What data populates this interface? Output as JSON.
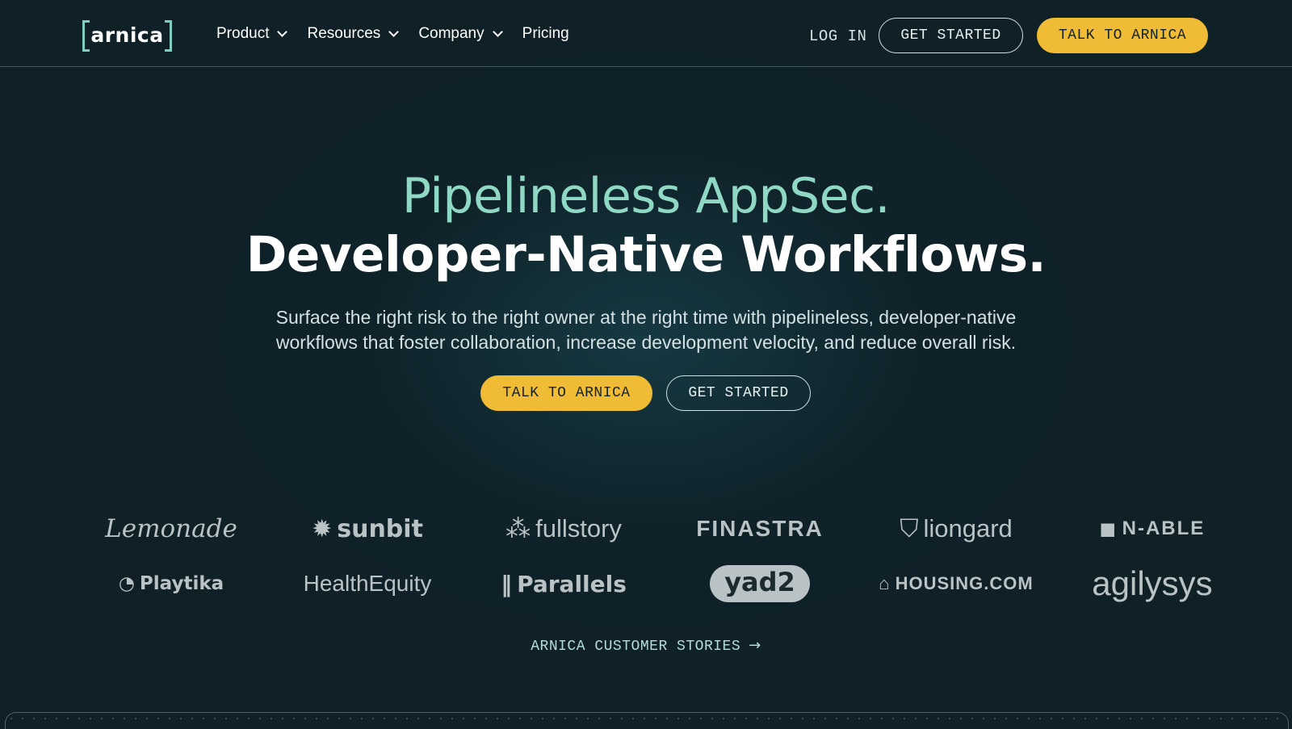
{
  "header": {
    "logo_text": "arnica",
    "nav": [
      {
        "label": "Product",
        "has_dropdown": true
      },
      {
        "label": "Resources",
        "has_dropdown": true
      },
      {
        "label": "Company",
        "has_dropdown": true
      },
      {
        "label": "Pricing",
        "has_dropdown": false
      }
    ],
    "login_label": "LOG IN",
    "get_started_label": "GET STARTED",
    "talk_label": "TALK TO ARNICA"
  },
  "hero": {
    "title_line1": "Pipelineless AppSec.",
    "title_line2": "Developer-Native Workflows.",
    "subtitle": "Surface the right risk to the right owner at the right time with pipelineless, developer-native workflows that foster collaboration, increase development velocity, and reduce overall risk.",
    "cta_primary": "TALK TO ARNICA",
    "cta_secondary": "GET STARTED"
  },
  "customers": {
    "logos": [
      "Lemonade",
      "sunbit",
      "fullstory",
      "FINASTRA",
      "liongard",
      "N-ABLE",
      "Playtika",
      "HealthEquity",
      "Parallels",
      "yad2",
      "HOUSING.COM",
      "agilysys"
    ],
    "stories_label": "ARNICA CUSTOMER STORIES"
  },
  "colors": {
    "accent_teal": "#8fd8c4",
    "accent_yellow": "#f0bb35",
    "background": "#0f2027"
  }
}
